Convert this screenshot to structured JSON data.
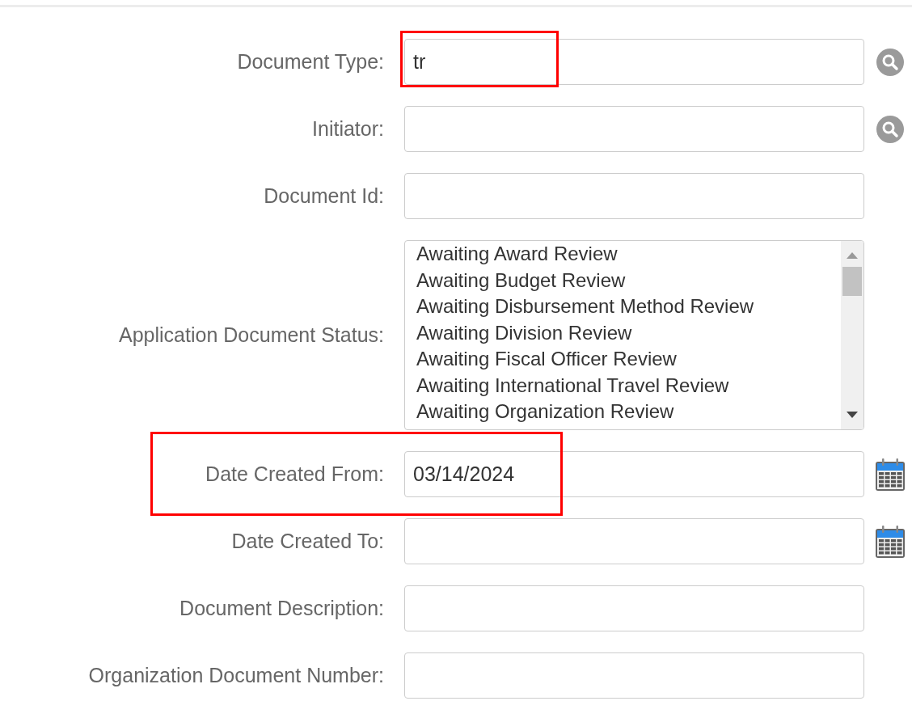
{
  "fields": [
    {
      "kind": "lookup",
      "label": "Document Type:",
      "value": "tr",
      "highlight_value": true
    },
    {
      "kind": "lookup",
      "label": "Initiator:"
    },
    {
      "kind": "text",
      "label": "Document Id:"
    },
    {
      "kind": "listbox",
      "label": "Application Document Status:",
      "options": [
        "Awaiting Award Review",
        "Awaiting Budget Review",
        "Awaiting Disbursement Method Review",
        "Awaiting Division Review",
        "Awaiting Fiscal Officer Review",
        "Awaiting International Travel Review",
        "Awaiting Organization Review"
      ]
    },
    {
      "kind": "date",
      "label": "Date Created From:",
      "value": "03/14/2024",
      "highlight_row": true
    },
    {
      "kind": "date",
      "label": "Date Created To:"
    },
    {
      "kind": "text",
      "label": "Document Description:"
    },
    {
      "kind": "text",
      "label": "Organization Document Number:"
    }
  ]
}
